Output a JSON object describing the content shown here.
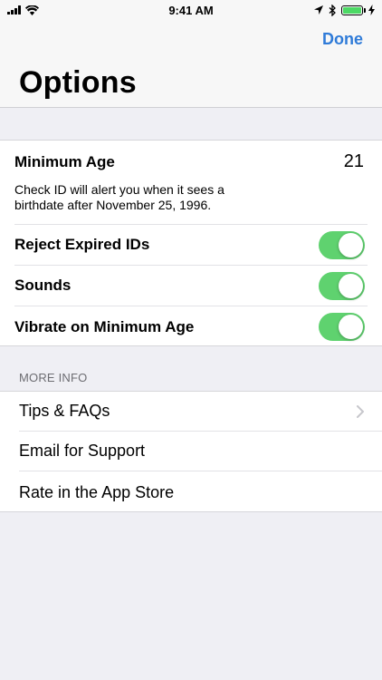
{
  "status_bar": {
    "time": "9:41 AM",
    "battery_color": "#4cd964"
  },
  "header": {
    "done_label": "Done",
    "title": "Options",
    "accent_color": "#2f7bd8"
  },
  "settings": {
    "min_age_label": "Minimum Age",
    "min_age_value": "21",
    "min_age_note": "Check ID will alert you when it sees a birthdate after November 25, 1996.",
    "toggles": [
      {
        "label": "Reject Expired IDs",
        "on": true
      },
      {
        "label": "Sounds",
        "on": true
      },
      {
        "label": "Vibrate on Minimum Age",
        "on": true
      }
    ],
    "toggle_on_color": "#5fd26f"
  },
  "more_info": {
    "header": "MORE INFO",
    "items": [
      {
        "label": "Tips & FAQs",
        "icon": "chevron-right-icon"
      },
      {
        "label": "Email for Support"
      },
      {
        "label": "Rate in the App Store"
      }
    ]
  }
}
